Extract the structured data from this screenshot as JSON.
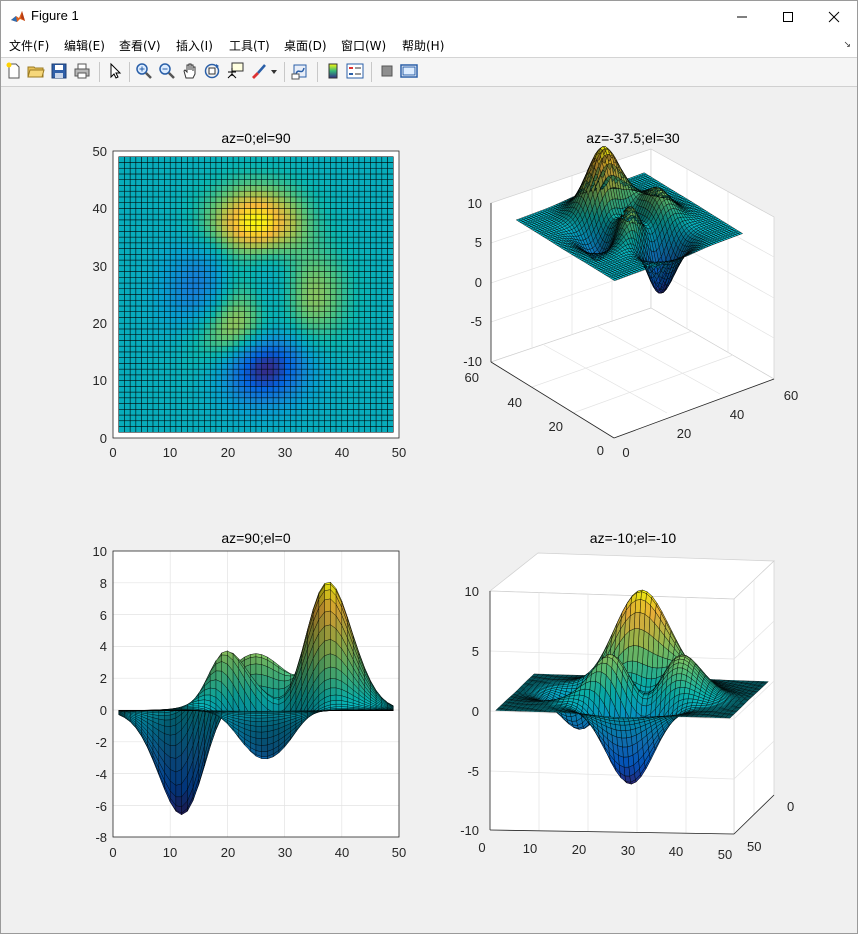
{
  "window": {
    "title": "Figure 1",
    "minimize_icon": "minimize-icon",
    "maximize_icon": "maximize-icon",
    "close_icon": "close-icon"
  },
  "menu": {
    "items": [
      "文件(F)",
      "编辑(E)",
      "查看(V)",
      "插入(I)",
      "工具(T)",
      "桌面(D)",
      "窗口(W)",
      "帮助(H)"
    ]
  },
  "toolbar": {
    "icons": [
      "new-figure-icon",
      "open-file-icon",
      "save-icon",
      "print-icon",
      "pointer-icon",
      "zoom-in-icon",
      "zoom-out-icon",
      "pan-hand-icon",
      "rotate-3d-icon",
      "data-cursor-icon",
      "brush-icon",
      "brush-dropdown-icon",
      "link-plot-icon",
      "colorbar-icon",
      "legend-icon",
      "hide-plot-tools-icon",
      "show-plot-tools-icon"
    ]
  },
  "subplots": {
    "p1": {
      "title": "az=0;el=90",
      "xticks": [
        "0",
        "10",
        "20",
        "30",
        "40",
        "50"
      ],
      "yticks": [
        "0",
        "10",
        "20",
        "30",
        "40",
        "50"
      ]
    },
    "p2": {
      "title": "az=-37.5;el=30",
      "zticks": [
        "10",
        "5",
        "0",
        "-5",
        "-10"
      ],
      "yticks": [
        "60",
        "40",
        "20",
        "0"
      ],
      "xticks": [
        "0",
        "20",
        "40",
        "60"
      ]
    },
    "p3": {
      "title": "az=90;el=0",
      "yticks": [
        "10",
        "8",
        "6",
        "4",
        "2",
        "0",
        "-2",
        "-4",
        "-6",
        "-8"
      ],
      "xticks": [
        "0",
        "10",
        "20",
        "30",
        "40",
        "50"
      ]
    },
    "p4": {
      "title": "az=-10;el=-10",
      "zticks": [
        "10",
        "5",
        "0",
        "-5",
        "-10"
      ],
      "xticks": [
        "0",
        "10",
        "20",
        "30",
        "40",
        "50"
      ],
      "yticks": [
        "0",
        "50"
      ]
    }
  },
  "chart_data": [
    {
      "type": "heatmap",
      "title": "az=0;el=90",
      "surface": "peaks(49)",
      "xlim": [
        0,
        50
      ],
      "ylim": [
        0,
        50
      ],
      "zlim": [
        -10,
        10
      ],
      "colormap": "parula",
      "grid": true
    },
    {
      "type": "area",
      "title": "az=-37.5;el=30",
      "surface": "peaks(49)",
      "xlim": [
        0,
        60
      ],
      "ylim": [
        0,
        60
      ],
      "zlim": [
        -10,
        10
      ],
      "view": {
        "az": -37.5,
        "el": 30
      },
      "colormap": "parula",
      "grid": true
    },
    {
      "type": "area",
      "title": "az=90;el=0",
      "surface": "peaks(49)",
      "xlim": [
        0,
        50
      ],
      "ylim": [
        -8,
        10
      ],
      "view": {
        "az": 90,
        "el": 0
      },
      "colormap": "parula",
      "grid": true
    },
    {
      "type": "area",
      "title": "az=-10;el=-10",
      "surface": "peaks(49)",
      "xlim": [
        0,
        50
      ],
      "ylim": [
        0,
        50
      ],
      "zlim": [
        -10,
        10
      ],
      "view": {
        "az": -10,
        "el": -10
      },
      "colormap": "parula",
      "grid": true
    }
  ]
}
